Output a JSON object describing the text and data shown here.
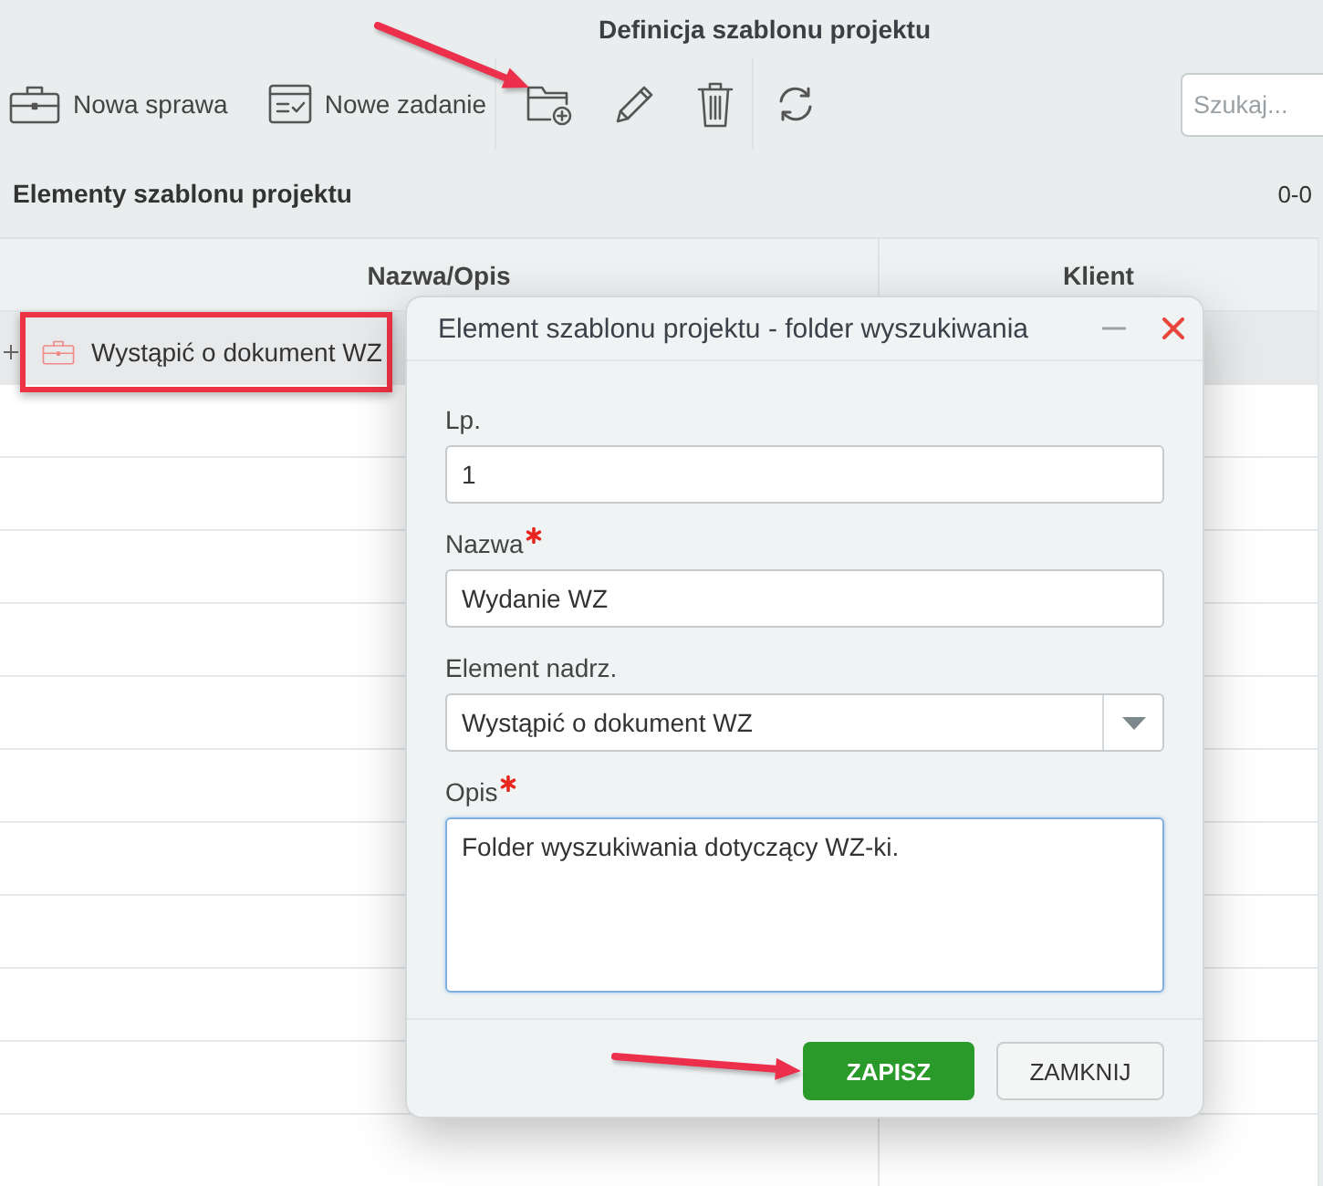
{
  "window": {
    "title": "Definicja szablonu projektu"
  },
  "toolbar": {
    "groups": [
      {
        "items": [
          {
            "label": "Nowa sprawa",
            "annotated": false
          },
          {
            "label": "Nowe zadanie",
            "annotated": false
          }
        ]
      },
      {
        "items": [
          {
            "annotated": true
          },
          {
            "annotated": false
          },
          {
            "annotated": false
          }
        ]
      },
      {
        "items": [
          {
            "annotated": false
          }
        ]
      }
    ],
    "search": {
      "placeholder": "Szukaj..."
    }
  },
  "section": {
    "title": "Elementy szablonu projektu",
    "count": "0-0"
  },
  "table": {
    "columns": [
      "Nazwa/Opis",
      "Klient"
    ],
    "rows": [
      {
        "name": "Wystąpić o dokument WZ",
        "expanded": false,
        "selected": true,
        "annotated": true
      }
    ]
  },
  "dialog": {
    "title": "Element szablonu projektu - folder wyszukiwania",
    "fields": [
      {
        "kind": "text",
        "label": "Lp.",
        "value": "1",
        "required": false,
        "focused": false
      },
      {
        "kind": "text",
        "label": "Nazwa",
        "value": "Wydanie WZ",
        "required": true,
        "focused": false
      },
      {
        "kind": "select",
        "label": "Element nadrz.",
        "value": "Wystąpić o dokument WZ",
        "required": false,
        "focused": false
      },
      {
        "kind": "textarea",
        "label": "Opis",
        "value": "Folder wyszukiwania dotyczący WZ-ki.",
        "required": true,
        "focused": true
      }
    ],
    "buttons": [
      {
        "kind": "primary",
        "label": "ZAPISZ",
        "annotated": true
      },
      {
        "kind": "secondary",
        "label": "ZAMKNIJ",
        "annotated": false
      }
    ]
  }
}
